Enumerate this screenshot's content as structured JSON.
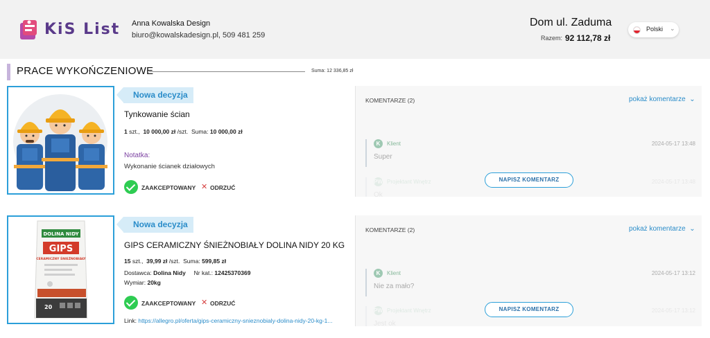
{
  "header": {
    "logo_text": "KiS List",
    "company_name": "Anna Kowalska Design",
    "contact": "biuro@kowalskadesign.pl, 509 481 259",
    "project_title": "Dom ul. Zaduma",
    "total_label": "Razem:",
    "total_value": "92 112,78 zł",
    "language": "Polski"
  },
  "section": {
    "title": "PRACE WYKOŃCZENIOWE",
    "sum": "Suma: 12 336,85 zł"
  },
  "items": [
    {
      "badge": "Nowa decyzja",
      "name": "Tynkowanie ścian",
      "qty": "1",
      "qty_unit": "szt.,",
      "unit_price": "10 000,00 zł",
      "per_unit": "/szt.",
      "sum_label": "Suma:",
      "sum_value": "10 000,00 zł",
      "note_label": "Notatka:",
      "note_text": "Wykonanie ścianek działowych",
      "accept_label": "ZAAKCEPTOWANY",
      "reject_label": "ODRZUĆ",
      "comments": {
        "title": "KOMENTARZE (2)",
        "toggle": "pokaż komentarze",
        "entries": [
          {
            "avatar": "K",
            "author": "Klient",
            "time": "2024-05-17 13:48",
            "text": "Super"
          },
          {
            "avatar": "PW",
            "author": "Projektant Wnętrz",
            "time": "2024-05-17 13:48",
            "text": "Ok"
          }
        ],
        "write_button": "NAPISZ KOMENTARZ"
      }
    },
    {
      "badge": "Nowa decyzja",
      "name": "GIPS CERAMICZNY ŚNIEŻNOBIAŁY DOLINA NIDY 20 KG",
      "qty": "15",
      "qty_unit": "szt.,",
      "unit_price": "39,99 zł",
      "per_unit": "/szt.",
      "sum_label": "Suma:",
      "sum_value": "599,85 zł",
      "supplier_label": "Dostawca:",
      "supplier": "Dolina Nidy",
      "catalog_label": "Nr kat.:",
      "catalog": "12425370369",
      "dims_label": "Wymiar:",
      "dims": "20kg",
      "accept_label": "ZAAKCEPTOWANY",
      "reject_label": "ODRZUĆ",
      "link_label": "Link:",
      "link": "https://allegro.pl/oferta/gips-ceramiczny-snieznobialy-dolina-nidy-20-kg-1...",
      "product_brand": "DOLINA NIDY",
      "product_name": "GIPS",
      "product_sub": "CERAMICZNY ŚNIEŻNOBIAŁY",
      "product_weight": "20",
      "comments": {
        "title": "KOMENTARZE (2)",
        "toggle": "pokaż komentarze",
        "entries": [
          {
            "avatar": "K",
            "author": "Klient",
            "time": "2024-05-17 13:12",
            "text": "Nie za mało?"
          },
          {
            "avatar": "PW",
            "author": "Projektant Wnętrz",
            "time": "2024-05-17 13:12",
            "text": "Jest ok"
          }
        ],
        "write_button": "NAPISZ KOMENTARZ"
      }
    }
  ],
  "colors": {
    "accent": "#2b9fd9",
    "badge_bg": "#d6ecf8",
    "accept": "#2ecc52",
    "reject": "#d64040",
    "note": "#7a3fa0"
  }
}
